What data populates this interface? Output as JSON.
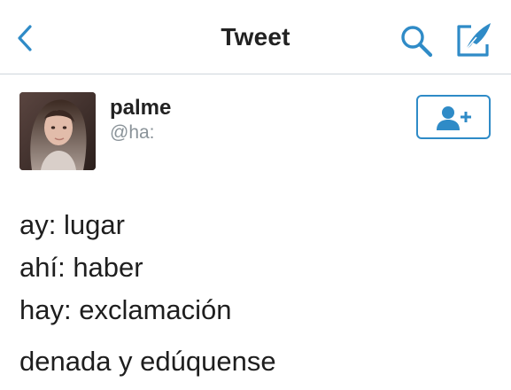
{
  "header": {
    "title": "Tweet",
    "accent_color": "#2f8bc7",
    "back_icon": "chevron-left-icon",
    "search_icon": "search-icon",
    "compose_icon": "compose-icon"
  },
  "tweet": {
    "author": {
      "name": "palme",
      "handle": "@ha:"
    },
    "follow_icon": "add-user-icon",
    "lines": [
      "ay: lugar",
      "ahí: haber",
      "hay: exclamación",
      "denada y edúquense"
    ]
  }
}
